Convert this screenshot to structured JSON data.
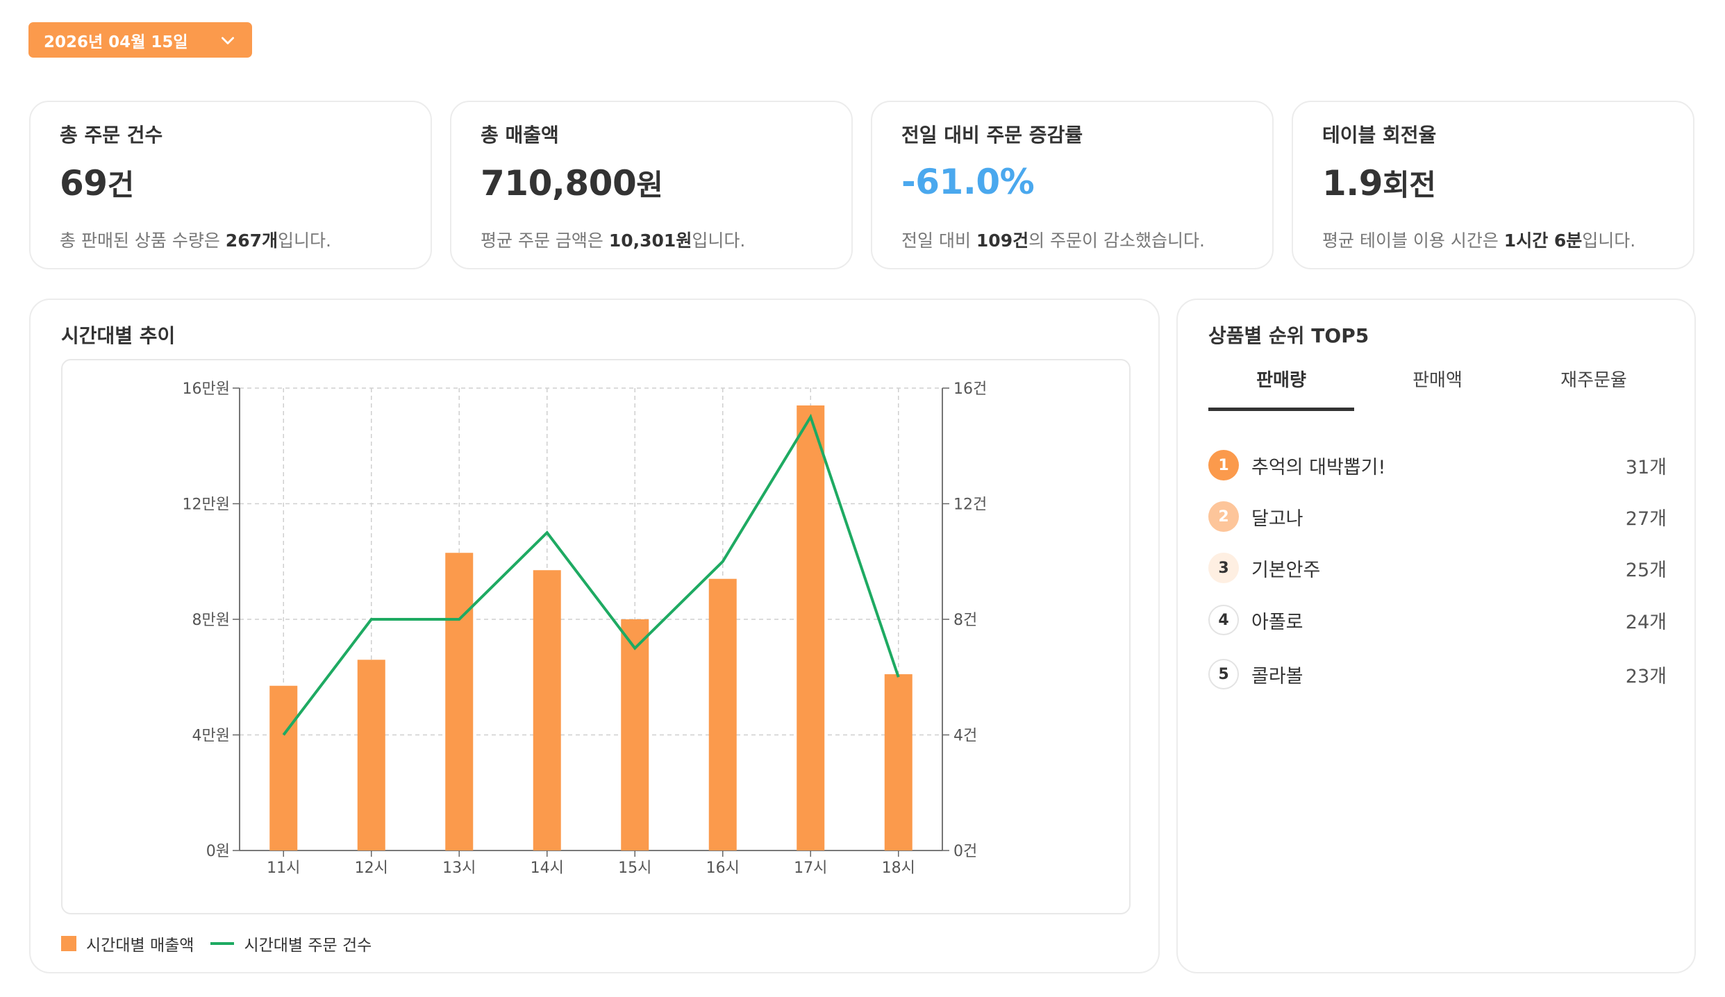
{
  "date_picker": {
    "label": "2026년 04월 15일"
  },
  "cards": [
    {
      "title": "총 주문 건수",
      "value": "69",
      "unit": "건",
      "sub_pre": "총 판매된 상품 수량은 ",
      "sub_bold": "267개",
      "sub_post": "입니다."
    },
    {
      "title": "총 매출액",
      "value": "710,800",
      "unit": "원",
      "sub_pre": "평균 주문 금액은 ",
      "sub_bold": "10,301원",
      "sub_post": "입니다."
    },
    {
      "title": "전일 대비 주문 증감률",
      "value": "-61.0%",
      "unit": "",
      "sub_pre": "전일 대비 ",
      "sub_bold": "109건",
      "sub_post": "의 주문이 감소했습니다."
    },
    {
      "title": "테이블 회전율",
      "value": "1.9",
      "unit": "회전",
      "sub_pre": "평균 테이블 이용 시간은 ",
      "sub_bold": "1시간 6분",
      "sub_post": "입니다."
    }
  ],
  "colors": {
    "accent": "#fb9a4c",
    "line": "#1eaa62",
    "negative": "#4aa8ee"
  },
  "trend": {
    "title": "시간대별 추이",
    "legend_bar": "시간대별 매출액",
    "legend_line": "시간대별 주문 건수"
  },
  "chart_data": {
    "type": "bar",
    "categories": [
      "11시",
      "12시",
      "13시",
      "14시",
      "15시",
      "16시",
      "17시",
      "18시"
    ],
    "series": [
      {
        "name": "시간대별 매출액",
        "type": "bar",
        "axis": "left",
        "values": [
          57000,
          66000,
          103000,
          97000,
          80000,
          94000,
          154000,
          61000
        ]
      },
      {
        "name": "시간대별 주문 건수",
        "type": "line",
        "axis": "right",
        "values": [
          4,
          8,
          8,
          11,
          7,
          10,
          15,
          6
        ]
      }
    ],
    "y_left": {
      "ylim": [
        0,
        160000
      ],
      "ticks": [
        "0원",
        "4만원",
        "8만원",
        "12만원",
        "16만원"
      ]
    },
    "y_right": {
      "ylim": [
        0,
        16
      ],
      "ticks": [
        "0건",
        "4건",
        "8건",
        "12건",
        "16건"
      ]
    },
    "grid": true,
    "legend": "bottom-left"
  },
  "ranking": {
    "title": "상품별 순위 TOP5",
    "tabs": [
      "판매량",
      "판매액",
      "재주문율"
    ],
    "active_tab": 0,
    "items": [
      {
        "rank": "1",
        "name": "추억의 대박뽑기!",
        "value": "31개"
      },
      {
        "rank": "2",
        "name": "달고나",
        "value": "27개"
      },
      {
        "rank": "3",
        "name": "기본안주",
        "value": "25개"
      },
      {
        "rank": "4",
        "name": "아폴로",
        "value": "24개"
      },
      {
        "rank": "5",
        "name": "콜라볼",
        "value": "23개"
      }
    ]
  }
}
